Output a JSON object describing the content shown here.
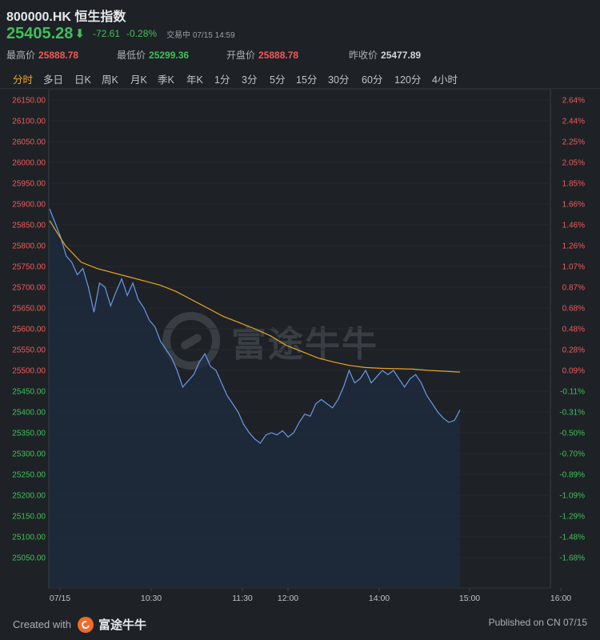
{
  "header": {
    "symbol_title": "800000.HK 恒生指数",
    "price": "25405.28",
    "arrow": "⬇",
    "change": "-72.61",
    "change_pct": "-0.28%",
    "status": "交易中 07/15 14:59"
  },
  "stats": [
    {
      "label": "最高价",
      "value": "25888.78",
      "color": "red"
    },
    {
      "label": "最低价",
      "value": "25299.36",
      "color": "green"
    },
    {
      "label": "开盘价",
      "value": "25888.78",
      "color": "red"
    },
    {
      "label": "昨收价",
      "value": "25477.89",
      "color": "gray"
    }
  ],
  "tabs": [
    "分时",
    "多日",
    "日K",
    "周K",
    "月K",
    "季K",
    "年K",
    "1分",
    "3分",
    "5分",
    "15分",
    "30分",
    "60分",
    "120分",
    "4小时"
  ],
  "active_tab": "分时",
  "watermark": "富途牛牛",
  "footer": {
    "created_with": "Created with",
    "brand": "富途牛牛",
    "published": "Published on CN 07/15"
  },
  "colors": {
    "price_line": "#6a9ae8",
    "avg_line": "#e8a524",
    "up": "#f05a5a",
    "down": "#3fc058",
    "background": "#1e2226"
  },
  "chart_data": {
    "type": "line",
    "title": "800000.HK 恒生指数",
    "ylim": [
      25000,
      26175
    ],
    "ytick_labels": [
      "26150.00",
      "26100.00",
      "26050.00",
      "26000.00",
      "25950.00",
      "25900.00",
      "25850.00",
      "25800.00",
      "25750.00",
      "25700.00",
      "25650.00",
      "25600.00",
      "25550.00",
      "25500.00",
      "25450.00",
      "25400.00",
      "25350.00",
      "25300.00",
      "25250.00",
      "25200.00",
      "25150.00",
      "25100.00",
      "25050.00"
    ],
    "ytick_labels_right": [
      "2.64%",
      "2.44%",
      "2.25%",
      "2.05%",
      "1.85%",
      "1.66%",
      "1.46%",
      "1.26%",
      "1.07%",
      "0.87%",
      "0.68%",
      "0.48%",
      "0.28%",
      "0.09%",
      "-0.11%",
      "-0.31%",
      "-0.50%",
      "-0.70%",
      "-0.89%",
      "-1.09%",
      "-1.29%",
      "-1.48%",
      "-1.68%"
    ],
    "xtick_labels": [
      "07/15",
      "10:30",
      "11:30",
      "12:00",
      "14:00",
      "15:00",
      "16:00"
    ],
    "previous_close": 25477.89,
    "series": [
      {
        "name": "",
        "values": [
          25888,
          25855,
          25820,
          25775,
          25760,
          25730,
          25745,
          25700,
          25640,
          25710,
          25700,
          25655,
          25690,
          25720,
          25680,
          25710,
          25670,
          25650,
          25620,
          25605,
          25570,
          25550,
          25530,
          25500,
          25460,
          25475,
          25490,
          25520,
          25540,
          25510,
          25500,
          25470,
          25440,
          25420,
          25400,
          25370,
          25350,
          25335,
          25325,
          25345,
          25350,
          25345,
          25355,
          25340,
          25350,
          25375,
          25395,
          25390,
          25420,
          25430,
          25420,
          25410,
          25430,
          25460,
          25500,
          25470,
          25480,
          25500,
          25470,
          25485,
          25500,
          25490,
          25500,
          25480,
          25460,
          25480,
          25490,
          25470,
          25440,
          25420,
          25400,
          25385,
          25375,
          25380,
          25405
        ]
      },
      {
        "name": "",
        "values": [
          25860,
          25800,
          25760,
          25745,
          25735,
          25725,
          25715,
          25705,
          25690,
          25670,
          25650,
          25630,
          25615,
          25600,
          25583,
          25560,
          25545,
          25530,
          25520,
          25512,
          25507,
          25505,
          25504,
          25503,
          25500,
          25498,
          25496
        ]
      }
    ]
  }
}
